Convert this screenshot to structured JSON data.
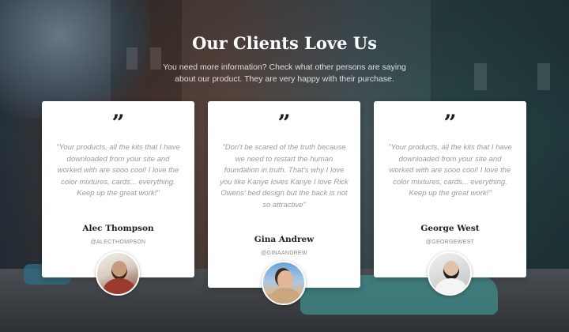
{
  "section": {
    "title": "Our Clients Love Us",
    "subtitle": "You need more information? Check what other persons are saying about our product. They are very happy with their purchase."
  },
  "testimonials": [
    {
      "quote_icon": "quote-icon",
      "text": "\"Your products, all the kits that I have downloaded from your site and worked with are sooo cool! I love the color mixtures, cards... everything. Keep up the great work!\"",
      "name": "Alec Thompson",
      "handle": "@ALECTHOMPSON"
    },
    {
      "quote_icon": "quote-icon",
      "text": "\"Don't be scared of the truth because we need to restart the human foundation in truth. That's why I love you like Kanye loves Kanye I love Rick Owens' bed design but the back is not so attractive\"",
      "name": "Gina Andrew",
      "handle": "@GINAANDREW"
    },
    {
      "quote_icon": "quote-icon",
      "text": "\"Your products, all the kits that I have downloaded from your site and worked with are sooo cool! I love the color mixtures, cards... everything. Keep up the great work!\"",
      "name": "George West",
      "handle": "@GEORGEWEST"
    }
  ],
  "colors": {
    "card_bg": "#ffffff",
    "quote_text": "#9a9a9a",
    "name_text": "#1f1f1f",
    "heading": "#ffffff"
  }
}
